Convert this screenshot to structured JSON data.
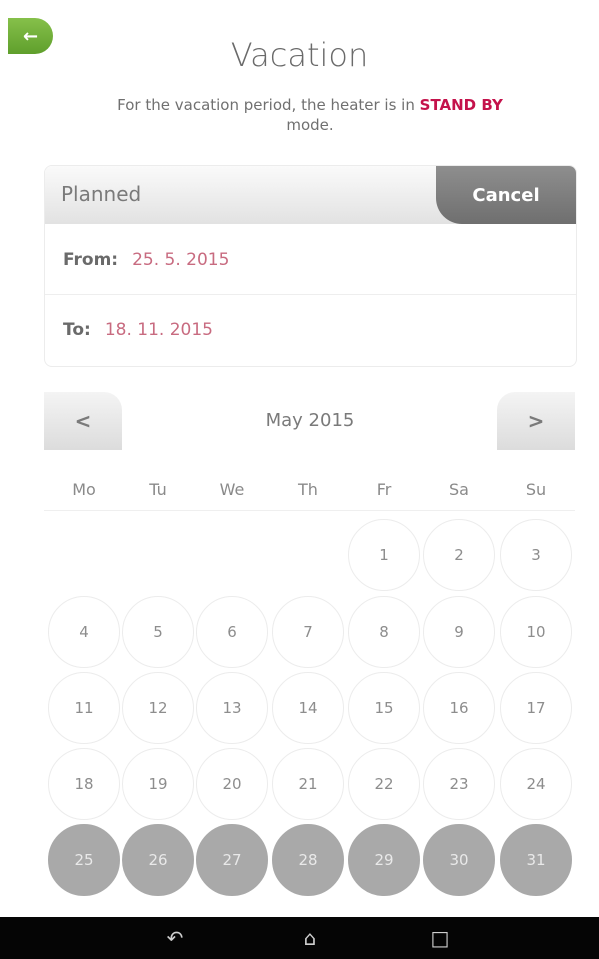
{
  "header": {
    "back_icon": "arrow-left-icon",
    "title": "Vacation",
    "subtitle_prefix": "For the vacation period, the heater is in",
    "subtitle_highlight": "STAND BY",
    "subtitle_suffix": "mode.",
    "highlight_color": "#c4124b"
  },
  "planned": {
    "label": "Planned",
    "cancel_label": "Cancel",
    "from_label": "From:",
    "from_value": "25. 5. 2015",
    "to_label": "To:",
    "to_value": "18. 11. 2015"
  },
  "calendar": {
    "prev_label": "<",
    "next_label": ">",
    "month_label": "May 2015",
    "weekdays": [
      "Mo",
      "Tu",
      "We",
      "Th",
      "Fr",
      "Sa",
      "Su"
    ],
    "first_day_column": 4,
    "days": [
      "1",
      "2",
      "3",
      "4",
      "5",
      "6",
      "7",
      "8",
      "9",
      "10",
      "11",
      "12",
      "13",
      "14",
      "15",
      "16",
      "17",
      "18",
      "19",
      "20",
      "21",
      "22",
      "23",
      "24",
      "25",
      "26",
      "27",
      "28",
      "29",
      "30",
      "31"
    ],
    "selected_from_day": 25
  },
  "system_bar": {
    "icons": [
      "back-nav-icon",
      "home-nav-icon",
      "recent-apps-icon"
    ]
  }
}
